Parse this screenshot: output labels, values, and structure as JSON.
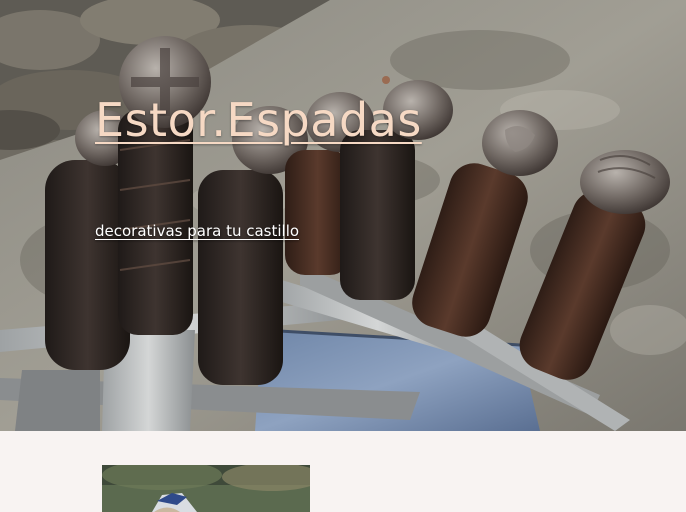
{
  "site": {
    "title": "Estor.Espadas",
    "tagline": "decorativas para tu castillo"
  },
  "hero_image": {
    "subject": "row of medieval sword hilts resting on stone"
  },
  "content_image": {
    "subject": "post thumbnail image"
  },
  "colors": {
    "page_background": "#f8f3f2",
    "title_text": "#f6d9c4",
    "tagline_text": "#ffffff"
  }
}
